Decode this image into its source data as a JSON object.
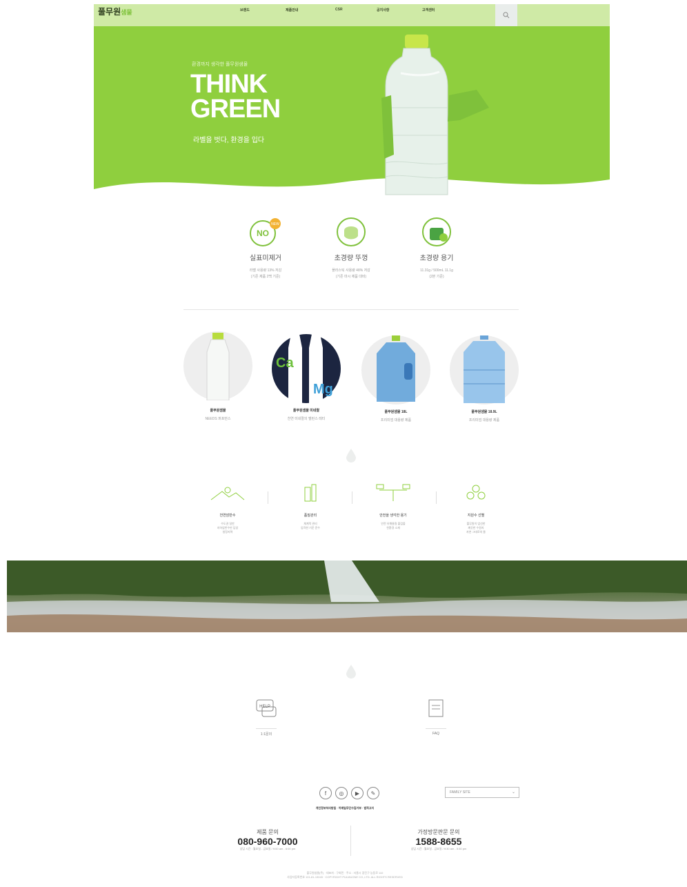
{
  "nav": {
    "logo": "풀무원",
    "logo_suffix": "샘물",
    "items": [
      "브랜드",
      "제품안내",
      "CSR",
      "공지사항",
      "고객센터"
    ]
  },
  "hero": {
    "kicker": "환경까지 생각한 풀무원샘물",
    "title_line1": "THINK",
    "title_line2": "GREEN",
    "subtitle": "라벨을 벗다, 환경을 입다"
  },
  "features": [
    {
      "title": "실표미제거",
      "desc1": "라벨 사용량 13% 저감",
      "desc2": "(기존 제품 2백 기준)",
      "badge": "NEW"
    },
    {
      "title": "초경량 뚜껑",
      "desc1": "플라스틱 사용량 48% 저감",
      "desc2": "(기존 마시 제품 대비)"
    },
    {
      "title": "초경량 용기",
      "desc1": "11.31g / 500mL 11.1g",
      "desc2": "(2본 기준)"
    }
  ],
  "products": [
    {
      "name": "풀무원샘물",
      "desc": "NEEDS 퍼포먼스"
    },
    {
      "name": "풀무원샘물 미네랄",
      "desc": "천연 미네랄의 밸런스 레터"
    },
    {
      "name": "풀무원샘물 18L",
      "desc": "프리미엄 대용량 제품"
    },
    {
      "name": "풀무원샘물 18.9L",
      "desc": "프리미엄 대용량 제품"
    }
  ],
  "promises": [
    {
      "title": "천연암반수",
      "desc1": "수도권 일반",
      "desc2": "지하암반수만 담았",
      "desc3": "청정지역"
    },
    {
      "title": "품질관리",
      "desc1": "체계적 관리",
      "desc2": "엄격한 기준 준수"
    },
    {
      "title": "안전을 생각한 용기",
      "desc1": "안전 유해물질 불검출",
      "desc2": "친환경 소재"
    },
    {
      "title": "지원수 선별",
      "desc1": "풀무원이 엄선한",
      "desc2": "깨끗한 수원지",
      "desc3": "자연 그대로의 물"
    }
  ],
  "support": [
    {
      "label": "1:1문의",
      "icon_text": "HELP"
    },
    {
      "label": "FAQ"
    }
  ],
  "footer": {
    "family_site": "FAMILY SITE",
    "links": "개인정보처리방침 · 이메일무단수집거부 · 법적고지",
    "cs_left_label": "제품 문의",
    "cs_left_phone": "080-960-7000",
    "cs_left_hours": "상담 시간 : 월요일 - 금요일 / 9:00 am - 6:00 pm",
    "cs_right_label": "가정방문판문 문의",
    "cs_right_phone": "1588-8655",
    "cs_right_hours": "상담 시간 : 월요일 - 금요일 / 9:30 am - 5:30 pm",
    "copy1": "풀무원샘물(주) · 대표자 : 구회민 · 주소 : 서울시 광진구 능동로 110",
    "copy2": "사업자등록번호 101-81-13045 · COPYRIGHT PULMUONE CO.,LTD. ALL RIGHTS RESERVED"
  },
  "colors": {
    "accent": "#8fcf3e",
    "nav_bg": "#cfeaa6"
  },
  "icons": [
    "search-icon",
    "facebook-icon",
    "instagram-icon",
    "youtube-icon",
    "blog-icon",
    "chevron-down-icon",
    "chat-help-icon",
    "faq-document-icon"
  ]
}
